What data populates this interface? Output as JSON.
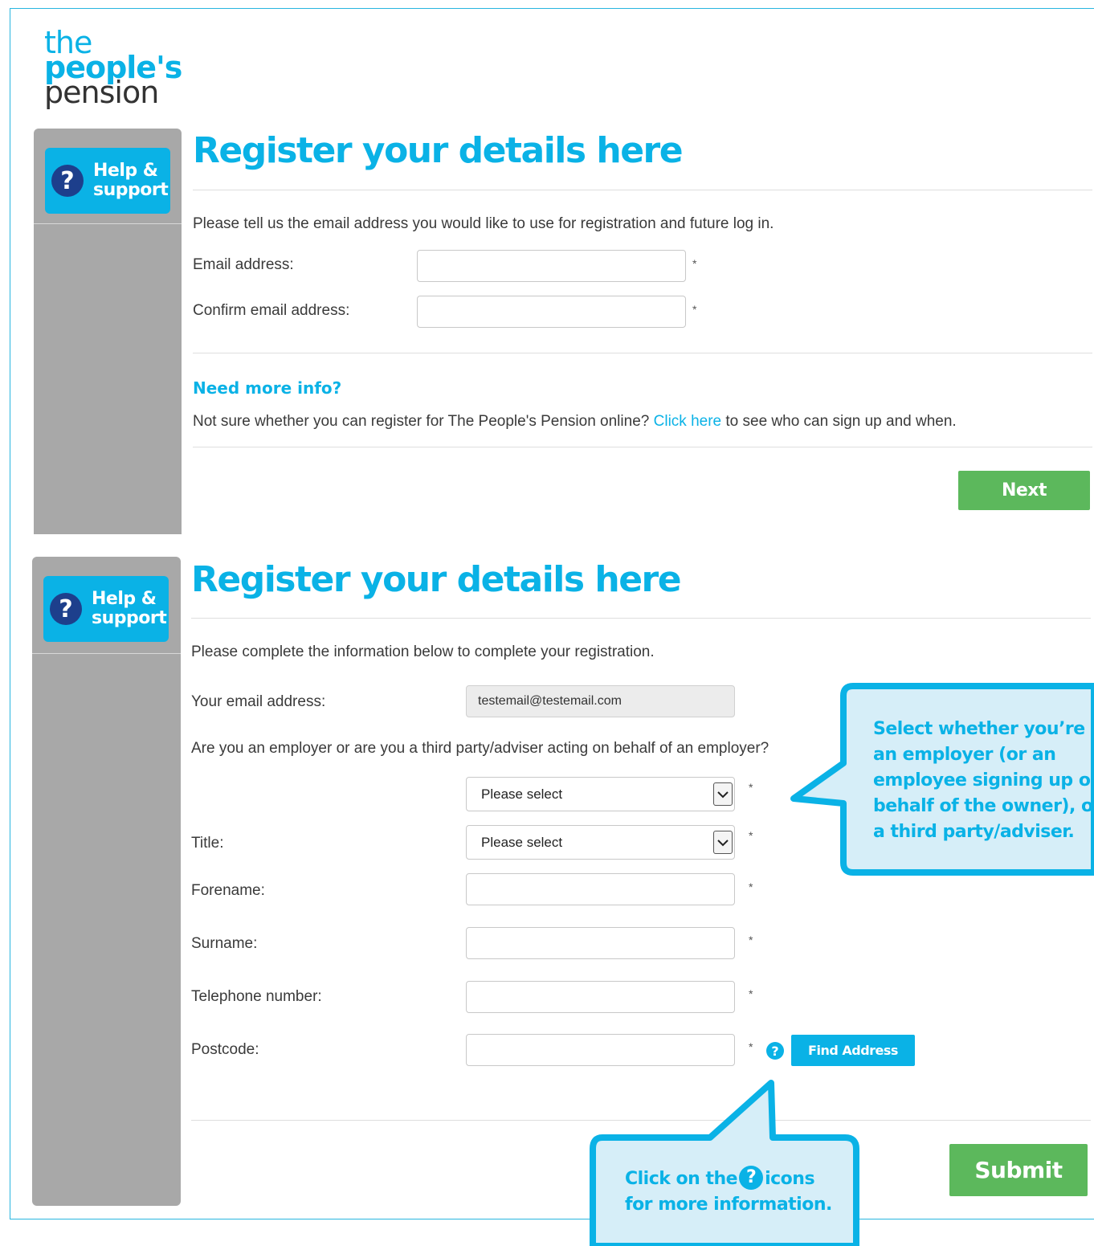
{
  "logo": {
    "line1": "the",
    "line2": "people's",
    "line3": "pension"
  },
  "help": {
    "line1": "Help &",
    "line2": "support",
    "icon_glyph": "?"
  },
  "section1": {
    "heading": "Register your details here",
    "intro": "Please tell us the email address you would like to use for registration and future log in.",
    "email_label": "Email address:",
    "confirm_label": "Confirm email address:",
    "email_value": "",
    "confirm_value": "",
    "required_marker": "*",
    "more_info_heading": "Need more info?",
    "more_info_prefix": "Not sure whether you can register for The People's Pension online?",
    "more_info_link": "Click here",
    "more_info_suffix": "to see who can sign up and when.",
    "next_label": "Next"
  },
  "section2": {
    "heading": "Register your details here",
    "intro": "Please complete the information below to complete your registration.",
    "your_email_label": "Your email address:",
    "your_email_value": "testemail@testemail.com",
    "employer_question": "Are you an employer or are you a third party/adviser acting on behalf of an employer?",
    "employer_select_value": "Please select",
    "title_label": "Title:",
    "title_select_value": "Please select",
    "forename_label": "Forename:",
    "surname_label": "Surname:",
    "telephone_label": "Telephone number:",
    "postcode_label": "Postcode:",
    "forename_value": "",
    "surname_value": "",
    "telephone_value": "",
    "postcode_value": "",
    "required_marker": "*",
    "info_glyph": "?",
    "find_address_label": "Find Address",
    "submit_label": "Submit"
  },
  "callouts": {
    "employer_tip": [
      "Select whether you’re",
      "an employer (or an",
      "employee signing up on",
      "behalf of the owner), or",
      "a third party/adviser."
    ],
    "icon_tip_prefix": "Click on the",
    "icon_tip_glyph": "?",
    "icon_tip_suffix": "icons",
    "icon_tip_line2": "for more information."
  },
  "colors": {
    "brand_blue": "#0ab2e6",
    "dark_blue": "#1d3f8c",
    "green": "#5cb85c",
    "sidebar_grey": "#a8a8a8",
    "callout_fill": "#d6eef8"
  }
}
